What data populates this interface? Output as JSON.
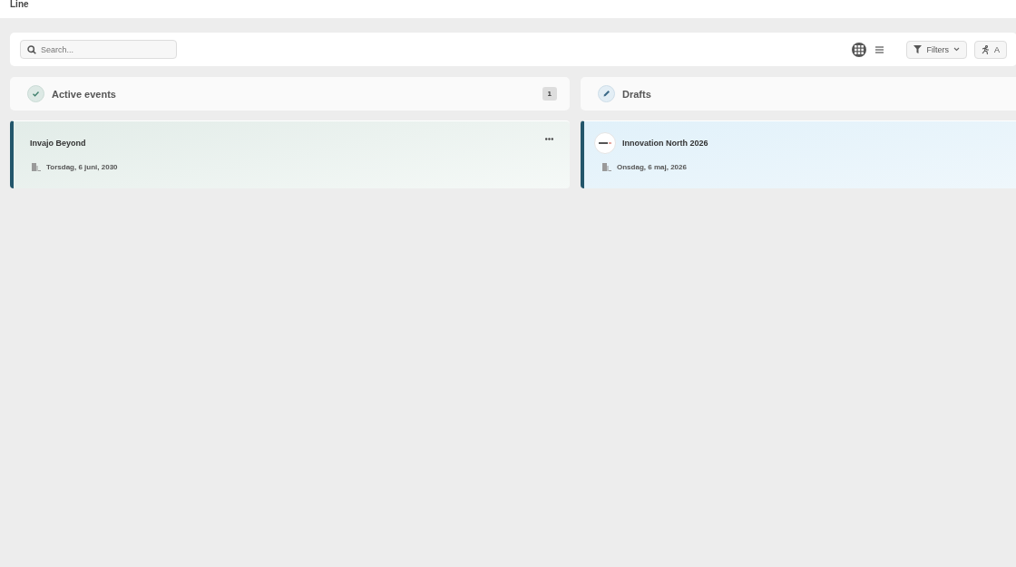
{
  "header": {
    "title": "Line"
  },
  "toolbar": {
    "search": {
      "placeholder": "Search..."
    },
    "views": [
      {
        "kind": "grid",
        "selected": true
      },
      {
        "kind": "list",
        "selected": false
      }
    ],
    "buttons": [
      {
        "kind": "filters",
        "label": "Filters"
      },
      {
        "kind": "activity",
        "label": "A"
      }
    ]
  },
  "columns": [
    {
      "kind": "active",
      "title": "Active events",
      "count": "1",
      "cards": [
        {
          "title": "Invajo Beyond",
          "date": "Torsdag, 6 juni, 2030",
          "logo": false,
          "menu": true
        }
      ]
    },
    {
      "kind": "drafts",
      "title": "Drafts",
      "cards": [
        {
          "title": "Innovation North 2026",
          "date": "Onsdag, 6 maj, 2026",
          "logo": true,
          "menu": false
        }
      ]
    }
  ]
}
